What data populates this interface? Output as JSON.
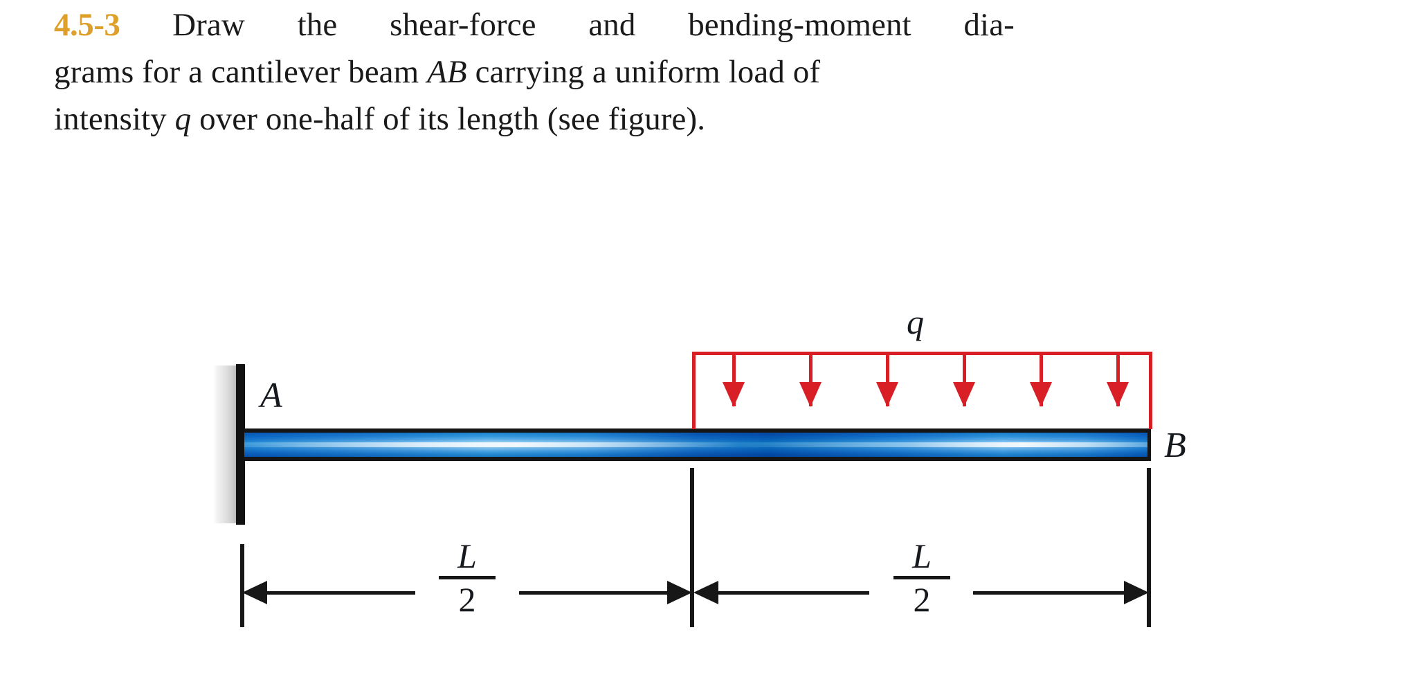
{
  "problem": {
    "number": "4.5-3",
    "line1_parts": [
      "Draw",
      "the",
      "shear-force",
      "and",
      "bending-moment",
      "dia-"
    ],
    "line2_pre": "grams for a cantilever beam ",
    "line2_italic": "AB",
    "line2_post": " carrying a uniform load of",
    "line3_pre": "intensity ",
    "line3_italic": "q",
    "line3_post": " over one-half of its length (see figure).",
    "full_text": "4.5-3 Draw the shear-force and bending-moment diagrams for a cantilever beam AB carrying a uniform load of intensity q over one-half of its length (see figure)."
  },
  "figure": {
    "support_label": "A",
    "free_end_label": "B",
    "load_label": "q",
    "left_dim": {
      "numerator": "L",
      "denominator": "2"
    },
    "right_dim": {
      "numerator": "L",
      "denominator": "2"
    },
    "load_arrow_count": 6,
    "description": "Cantilever beam AB fixed at A, uniform load q over right half"
  },
  "colors": {
    "problem_number": "#dda02a",
    "text": "#1a1a1a",
    "load_red": "#d81f26",
    "beam_blue": "#2f97d6",
    "outline_black": "#151515",
    "wall_gray": "#cfcfcf"
  }
}
